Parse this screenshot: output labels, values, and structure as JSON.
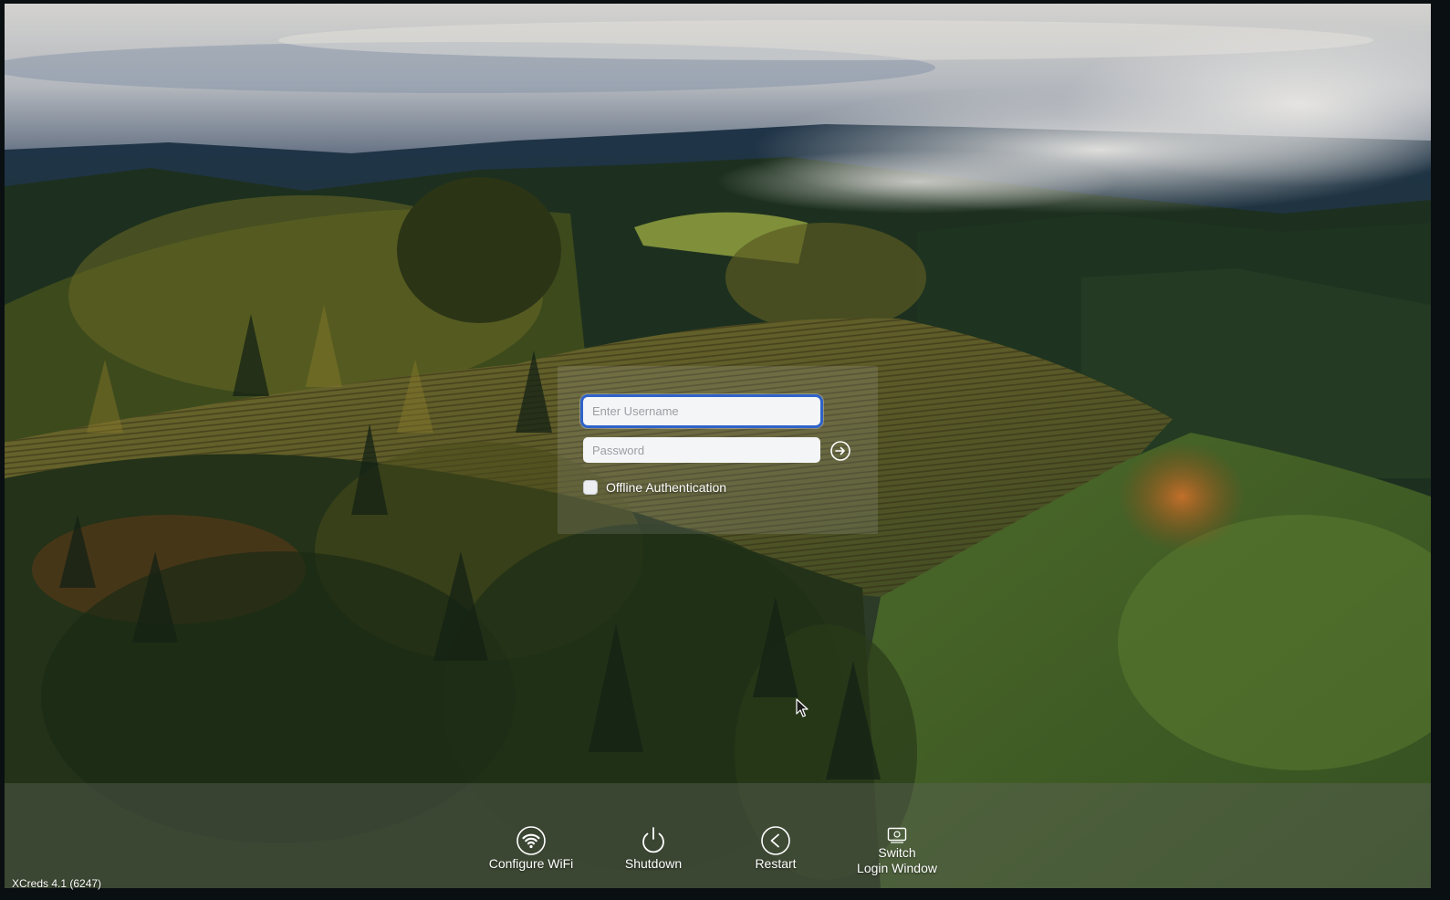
{
  "login": {
    "username_placeholder": "Enter Username",
    "username_value": "",
    "password_placeholder": "Password",
    "password_value": "",
    "submit_icon": "arrow-right-circle-icon",
    "offline_auth_label": "Offline Authentication",
    "offline_auth_checked": false
  },
  "bottom_bar": {
    "actions": [
      {
        "label": "Configure WiFi",
        "icon": "wifi-icon"
      },
      {
        "label": "Shutdown",
        "icon": "power-icon"
      },
      {
        "label": "Restart",
        "icon": "restart-icon"
      },
      {
        "label_line1": "Switch",
        "label_line2": "Login Window",
        "icon": "switch-window-icon"
      }
    ]
  },
  "version_text": "XCreds 4.1 (6247)",
  "colors": {
    "focus_ring": "#2f63c9",
    "field_background": "#f4f5f7",
    "panel_background": "rgba(190,190,200,0.16)",
    "bar_background": "rgba(95,100,90,0.42)"
  }
}
